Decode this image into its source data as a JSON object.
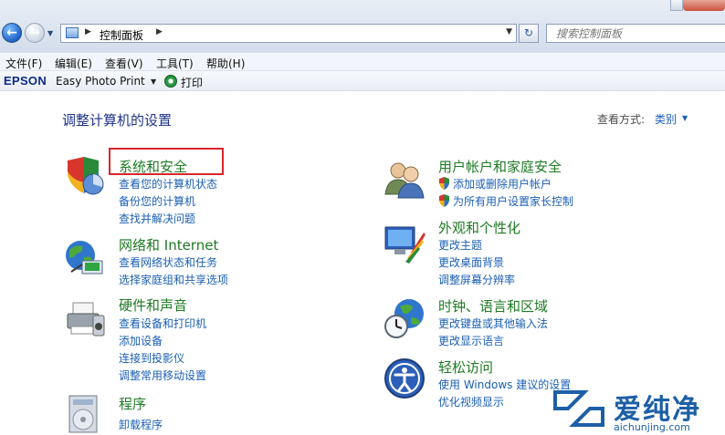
{
  "address": {
    "breadcrumb": "控制面板",
    "search_placeholder": "搜索控制面板"
  },
  "menu": {
    "items": [
      {
        "label": "文件(F)"
      },
      {
        "label": "编辑(E)"
      },
      {
        "label": "查看(V)"
      },
      {
        "label": "工具(T)"
      },
      {
        "label": "帮助(H)"
      }
    ]
  },
  "epson_toolbar": {
    "logo": "EPSON",
    "app": "Easy Photo Print",
    "print": "打印"
  },
  "content": {
    "title": "调整计算机的设置",
    "view_by_label": "查看方式:",
    "view_by_value": "类别"
  },
  "categories": {
    "system_security": {
      "title": "系统和安全",
      "links": [
        "查看您的计算机状态",
        "备份您的计算机",
        "查找并解决问题"
      ]
    },
    "network": {
      "title": "网络和 Internet",
      "links": [
        "查看网络状态和任务",
        "选择家庭组和共享选项"
      ]
    },
    "hardware": {
      "title": "硬件和声音",
      "links": [
        "查看设备和打印机",
        "添加设备",
        "连接到投影仪",
        "调整常用移动设置"
      ]
    },
    "programs": {
      "title": "程序",
      "links": [
        "卸载程序"
      ]
    },
    "users": {
      "title": "用户帐户和家庭安全",
      "links": [
        "添加或删除用户帐户",
        "为所有用户设置家长控制"
      ]
    },
    "appearance": {
      "title": "外观和个性化",
      "links": [
        "更改主题",
        "更改桌面背景",
        "调整屏幕分辨率"
      ]
    },
    "clock": {
      "title": "时钟、语言和区域",
      "links": [
        "更改键盘或其他输入法",
        "更改显示语言"
      ]
    },
    "ease": {
      "title": "轻松访问",
      "links": [
        "使用 Windows 建议的设置",
        "优化视频显示"
      ]
    }
  },
  "watermark": {
    "brand": "爱纯净",
    "url": "aichunjing.com"
  }
}
